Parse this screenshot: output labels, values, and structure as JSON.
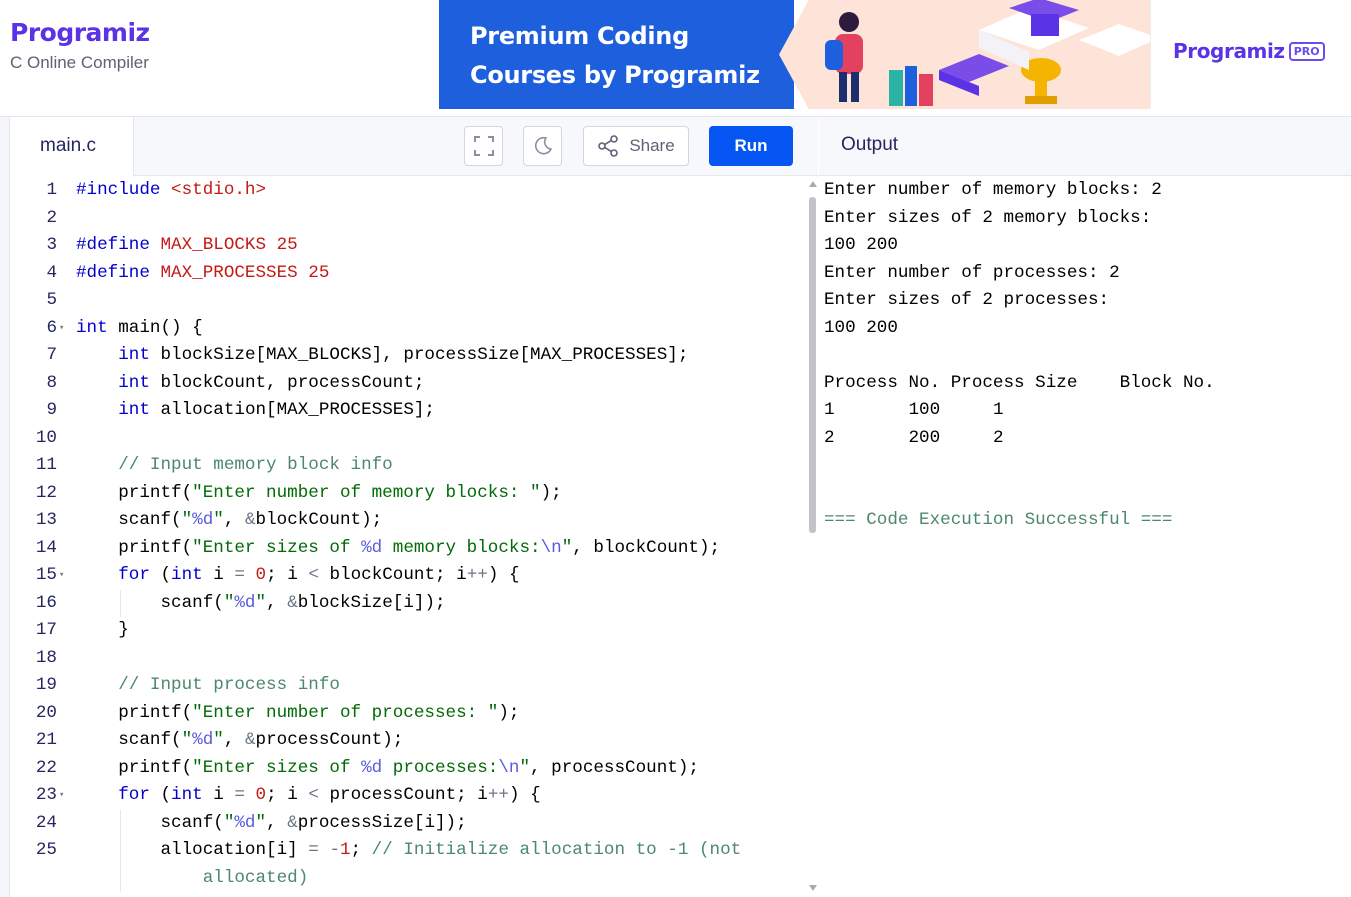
{
  "header": {
    "logo_text": "Programiz",
    "subtitle": "C Online Compiler"
  },
  "ad": {
    "title": "Premium Coding\nCourses by Programiz",
    "pro_logo": "Programiz",
    "pro_badge": "PRO"
  },
  "editor": {
    "file_tab": "main.c",
    "fullscreen_icon": "expand-icon",
    "theme_icon": "moon-icon",
    "share_icon": "share-icon",
    "share_label": "Share",
    "run_label": "Run",
    "lines": [
      {
        "n": "1",
        "fold": false,
        "html": "<span class=\"kw\">#include</span> <span class=\"inc\">&lt;stdio.h&gt;</span>"
      },
      {
        "n": "2",
        "fold": false,
        "html": ""
      },
      {
        "n": "3",
        "fold": false,
        "html": "<span class=\"kw\">#define</span> <span class=\"mac\">MAX_BLOCKS 25</span>"
      },
      {
        "n": "4",
        "fold": false,
        "html": "<span class=\"kw\">#define</span> <span class=\"mac\">MAX_PROCESSES 25</span>"
      },
      {
        "n": "5",
        "fold": false,
        "html": ""
      },
      {
        "n": "6",
        "fold": true,
        "html": "<span class=\"ty\">int</span> main() {"
      },
      {
        "n": "7",
        "fold": false,
        "indent": 1,
        "html": "    <span class=\"ty\">int</span> blockSize[MAX_BLOCKS], processSize[MAX_PROCESSES];"
      },
      {
        "n": "8",
        "fold": false,
        "indent": 1,
        "html": "    <span class=\"ty\">int</span> blockCount, processCount;"
      },
      {
        "n": "9",
        "fold": false,
        "indent": 1,
        "html": "    <span class=\"ty\">int</span> allocation[MAX_PROCESSES];"
      },
      {
        "n": "10",
        "fold": false,
        "html": ""
      },
      {
        "n": "11",
        "fold": false,
        "indent": 1,
        "html": "    <span class=\"cm\">// Input memory block info</span>"
      },
      {
        "n": "12",
        "fold": false,
        "indent": 1,
        "html": "    printf(<span class=\"str\">\"Enter number of memory blocks: \"</span>);"
      },
      {
        "n": "13",
        "fold": false,
        "indent": 1,
        "html": "    scanf(<span class=\"str\">\"<span class=\"esc\">%d</span>\"</span>, <span class=\"op\">&amp;</span>blockCount);"
      },
      {
        "n": "14",
        "fold": false,
        "indent": 1,
        "html": "    printf(<span class=\"str\">\"Enter sizes of <span class=\"esc\">%d</span> memory blocks:<span class=\"esc\">\\n</span>\"</span>, blockCount);"
      },
      {
        "n": "15",
        "fold": true,
        "indent": 1,
        "html": "    <span class=\"kw\">for</span> (<span class=\"ty\">int</span> i <span class=\"op\">=</span> <span class=\"num\">0</span>; i <span class=\"op\">&lt;</span> blockCount; i<span class=\"op\">++</span>) {"
      },
      {
        "n": "16",
        "fold": false,
        "indent": 2,
        "html": "        scanf(<span class=\"str\">\"<span class=\"esc\">%d</span>\"</span>, <span class=\"op\">&amp;</span>blockSize[i]);"
      },
      {
        "n": "17",
        "fold": false,
        "indent": 1,
        "html": "    }"
      },
      {
        "n": "18",
        "fold": false,
        "html": ""
      },
      {
        "n": "19",
        "fold": false,
        "indent": 1,
        "html": "    <span class=\"cm\">// Input process info</span>"
      },
      {
        "n": "20",
        "fold": false,
        "indent": 1,
        "html": "    printf(<span class=\"str\">\"Enter number of processes: \"</span>);"
      },
      {
        "n": "21",
        "fold": false,
        "indent": 1,
        "html": "    scanf(<span class=\"str\">\"<span class=\"esc\">%d</span>\"</span>, <span class=\"op\">&amp;</span>processCount);"
      },
      {
        "n": "22",
        "fold": false,
        "indent": 1,
        "html": "    printf(<span class=\"str\">\"Enter sizes of <span class=\"esc\">%d</span> processes:<span class=\"esc\">\\n</span>\"</span>, processCount);"
      },
      {
        "n": "23",
        "fold": true,
        "indent": 1,
        "html": "    <span class=\"kw\">for</span> (<span class=\"ty\">int</span> i <span class=\"op\">=</span> <span class=\"num\">0</span>; i <span class=\"op\">&lt;</span> processCount; i<span class=\"op\">++</span>) {"
      },
      {
        "n": "24",
        "fold": false,
        "indent": 2,
        "html": "        scanf(<span class=\"str\">\"<span class=\"esc\">%d</span>\"</span>, <span class=\"op\">&amp;</span>processSize[i]);"
      },
      {
        "n": "25",
        "fold": false,
        "indent": 2,
        "html": "        allocation[i] <span class=\"op\">=</span> <span class=\"op\">-</span><span class=\"num\">1</span>; <span class=\"cm\">// Initialize allocation to -1 (not</span>"
      },
      {
        "n": "",
        "fold": false,
        "indent": 2,
        "html": "            <span class=\"cm\">allocated)</span>"
      }
    ]
  },
  "output": {
    "title": "Output",
    "lines": [
      "Enter number of memory blocks: 2",
      "Enter sizes of 2 memory blocks:",
      "100 200",
      "Enter number of processes: 2",
      "Enter sizes of 2 processes:",
      "100 200",
      "",
      "Process No.\tProcess Size\tBlock No.",
      "1\t\t100\t\t1",
      "2\t\t200\t\t2",
      "",
      "",
      "=== Code Execution Successful ==="
    ],
    "success_line_index": 12
  }
}
